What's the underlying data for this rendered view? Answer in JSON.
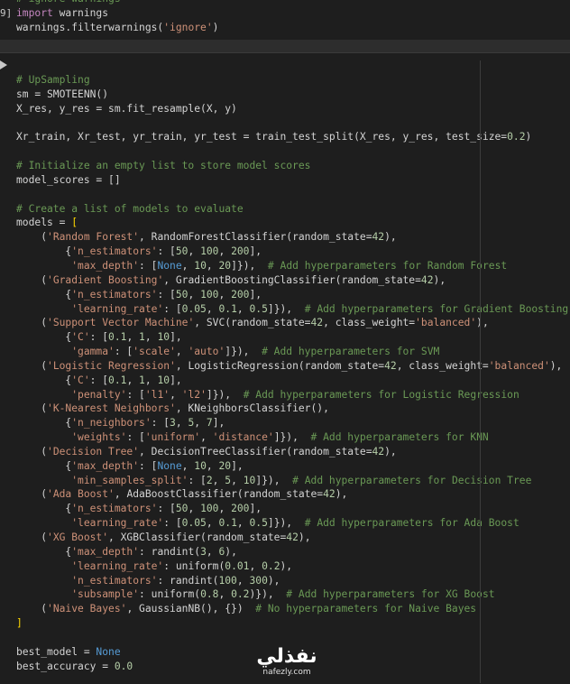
{
  "cells": [
    {
      "execution_count": "9]",
      "lines": [
        [
          {
            "t": "c",
            "s": "# ignore warnings"
          }
        ],
        [
          {
            "t": "k",
            "s": "import"
          },
          {
            "t": "p",
            "s": " warnings"
          }
        ],
        [
          {
            "t": "p",
            "s": "warnings.filterwarnings("
          },
          {
            "t": "s",
            "s": "'ignore'"
          },
          {
            "t": "p",
            "s": ")"
          }
        ]
      ]
    },
    {
      "lines": [
        [
          {
            "t": "c",
            "s": "# UpSampling"
          }
        ],
        [
          {
            "t": "p",
            "s": "sm = SMOTEENN()"
          }
        ],
        [
          {
            "t": "p",
            "s": "X_res, y_res = sm.fit_resample(X, y)"
          }
        ],
        [],
        [
          {
            "t": "p",
            "s": "Xr_train, Xr_test, yr_train, yr_test = train_test_split(X_res, y_res, test_size="
          },
          {
            "t": "n",
            "s": "0.2"
          },
          {
            "t": "p",
            "s": ")"
          }
        ],
        [],
        [
          {
            "t": "c",
            "s": "# Initialize an empty list to store model scores"
          }
        ],
        [
          {
            "t": "p",
            "s": "model_scores = []"
          }
        ],
        [],
        [
          {
            "t": "c",
            "s": "# Create a list of models to evaluate"
          }
        ],
        [
          {
            "t": "p",
            "s": "models = "
          },
          {
            "t": "b",
            "s": "["
          }
        ],
        [
          {
            "t": "p",
            "s": "    ("
          },
          {
            "t": "s",
            "s": "'Random Forest'"
          },
          {
            "t": "p",
            "s": ", RandomForestClassifier(random_state="
          },
          {
            "t": "n",
            "s": "42"
          },
          {
            "t": "p",
            "s": "),"
          }
        ],
        [
          {
            "t": "p",
            "s": "        {"
          },
          {
            "t": "s",
            "s": "'n_estimators'"
          },
          {
            "t": "p",
            "s": ": ["
          },
          {
            "t": "n",
            "s": "50"
          },
          {
            "t": "p",
            "s": ", "
          },
          {
            "t": "n",
            "s": "100"
          },
          {
            "t": "p",
            "s": ", "
          },
          {
            "t": "n",
            "s": "200"
          },
          {
            "t": "p",
            "s": "],"
          }
        ],
        [
          {
            "t": "p",
            "s": "         "
          },
          {
            "t": "s",
            "s": "'max_depth'"
          },
          {
            "t": "p",
            "s": ": ["
          },
          {
            "t": "kw",
            "s": "None"
          },
          {
            "t": "p",
            "s": ", "
          },
          {
            "t": "n",
            "s": "10"
          },
          {
            "t": "p",
            "s": ", "
          },
          {
            "t": "n",
            "s": "20"
          },
          {
            "t": "p",
            "s": "]}),  "
          },
          {
            "t": "c",
            "s": "# Add hyperparameters for Random Forest"
          }
        ],
        [
          {
            "t": "p",
            "s": "    ("
          },
          {
            "t": "s",
            "s": "'Gradient Boosting'"
          },
          {
            "t": "p",
            "s": ", GradientBoostingClassifier(random_state="
          },
          {
            "t": "n",
            "s": "42"
          },
          {
            "t": "p",
            "s": "),"
          }
        ],
        [
          {
            "t": "p",
            "s": "        {"
          },
          {
            "t": "s",
            "s": "'n_estimators'"
          },
          {
            "t": "p",
            "s": ": ["
          },
          {
            "t": "n",
            "s": "50"
          },
          {
            "t": "p",
            "s": ", "
          },
          {
            "t": "n",
            "s": "100"
          },
          {
            "t": "p",
            "s": ", "
          },
          {
            "t": "n",
            "s": "200"
          },
          {
            "t": "p",
            "s": "],"
          }
        ],
        [
          {
            "t": "p",
            "s": "         "
          },
          {
            "t": "s",
            "s": "'learning_rate'"
          },
          {
            "t": "p",
            "s": ": ["
          },
          {
            "t": "n",
            "s": "0.05"
          },
          {
            "t": "p",
            "s": ", "
          },
          {
            "t": "n",
            "s": "0.1"
          },
          {
            "t": "p",
            "s": ", "
          },
          {
            "t": "n",
            "s": "0.5"
          },
          {
            "t": "p",
            "s": "]}),  "
          },
          {
            "t": "c",
            "s": "# Add hyperparameters for Gradient Boosting"
          }
        ],
        [
          {
            "t": "p",
            "s": "    ("
          },
          {
            "t": "s",
            "s": "'Support Vector Machine'"
          },
          {
            "t": "p",
            "s": ", SVC(random_state="
          },
          {
            "t": "n",
            "s": "42"
          },
          {
            "t": "p",
            "s": ", class_weight="
          },
          {
            "t": "s",
            "s": "'balanced'"
          },
          {
            "t": "p",
            "s": "),"
          }
        ],
        [
          {
            "t": "p",
            "s": "        {"
          },
          {
            "t": "s",
            "s": "'C'"
          },
          {
            "t": "p",
            "s": ": ["
          },
          {
            "t": "n",
            "s": "0.1"
          },
          {
            "t": "p",
            "s": ", "
          },
          {
            "t": "n",
            "s": "1"
          },
          {
            "t": "p",
            "s": ", "
          },
          {
            "t": "n",
            "s": "10"
          },
          {
            "t": "p",
            "s": "],"
          }
        ],
        [
          {
            "t": "p",
            "s": "         "
          },
          {
            "t": "s",
            "s": "'gamma'"
          },
          {
            "t": "p",
            "s": ": ["
          },
          {
            "t": "s",
            "s": "'scale'"
          },
          {
            "t": "p",
            "s": ", "
          },
          {
            "t": "s",
            "s": "'auto'"
          },
          {
            "t": "p",
            "s": "]}),  "
          },
          {
            "t": "c",
            "s": "# Add hyperparameters for SVM"
          }
        ],
        [
          {
            "t": "p",
            "s": "    ("
          },
          {
            "t": "s",
            "s": "'Logistic Regression'"
          },
          {
            "t": "p",
            "s": ", LogisticRegression(random_state="
          },
          {
            "t": "n",
            "s": "42"
          },
          {
            "t": "p",
            "s": ", class_weight="
          },
          {
            "t": "s",
            "s": "'balanced'"
          },
          {
            "t": "p",
            "s": "),"
          }
        ],
        [
          {
            "t": "p",
            "s": "        {"
          },
          {
            "t": "s",
            "s": "'C'"
          },
          {
            "t": "p",
            "s": ": ["
          },
          {
            "t": "n",
            "s": "0.1"
          },
          {
            "t": "p",
            "s": ", "
          },
          {
            "t": "n",
            "s": "1"
          },
          {
            "t": "p",
            "s": ", "
          },
          {
            "t": "n",
            "s": "10"
          },
          {
            "t": "p",
            "s": "],"
          }
        ],
        [
          {
            "t": "p",
            "s": "         "
          },
          {
            "t": "s",
            "s": "'penalty'"
          },
          {
            "t": "p",
            "s": ": ["
          },
          {
            "t": "s",
            "s": "'l1'"
          },
          {
            "t": "p",
            "s": ", "
          },
          {
            "t": "s",
            "s": "'l2'"
          },
          {
            "t": "p",
            "s": "]}),  "
          },
          {
            "t": "c",
            "s": "# Add hyperparameters for Logistic Regression"
          }
        ],
        [
          {
            "t": "p",
            "s": "    ("
          },
          {
            "t": "s",
            "s": "'K-Nearest Neighbors'"
          },
          {
            "t": "p",
            "s": ", KNeighborsClassifier(),"
          }
        ],
        [
          {
            "t": "p",
            "s": "        {"
          },
          {
            "t": "s",
            "s": "'n_neighbors'"
          },
          {
            "t": "p",
            "s": ": ["
          },
          {
            "t": "n",
            "s": "3"
          },
          {
            "t": "p",
            "s": ", "
          },
          {
            "t": "n",
            "s": "5"
          },
          {
            "t": "p",
            "s": ", "
          },
          {
            "t": "n",
            "s": "7"
          },
          {
            "t": "p",
            "s": "],"
          }
        ],
        [
          {
            "t": "p",
            "s": "         "
          },
          {
            "t": "s",
            "s": "'weights'"
          },
          {
            "t": "p",
            "s": ": ["
          },
          {
            "t": "s",
            "s": "'uniform'"
          },
          {
            "t": "p",
            "s": ", "
          },
          {
            "t": "s",
            "s": "'distance'"
          },
          {
            "t": "p",
            "s": "]}),  "
          },
          {
            "t": "c",
            "s": "# Add hyperparameters for KNN"
          }
        ],
        [
          {
            "t": "p",
            "s": "    ("
          },
          {
            "t": "s",
            "s": "'Decision Tree'"
          },
          {
            "t": "p",
            "s": ", DecisionTreeClassifier(random_state="
          },
          {
            "t": "n",
            "s": "42"
          },
          {
            "t": "p",
            "s": "),"
          }
        ],
        [
          {
            "t": "p",
            "s": "        {"
          },
          {
            "t": "s",
            "s": "'max_depth'"
          },
          {
            "t": "p",
            "s": ": ["
          },
          {
            "t": "kw",
            "s": "None"
          },
          {
            "t": "p",
            "s": ", "
          },
          {
            "t": "n",
            "s": "10"
          },
          {
            "t": "p",
            "s": ", "
          },
          {
            "t": "n",
            "s": "20"
          },
          {
            "t": "p",
            "s": "],"
          }
        ],
        [
          {
            "t": "p",
            "s": "         "
          },
          {
            "t": "s",
            "s": "'min_samples_split'"
          },
          {
            "t": "p",
            "s": ": ["
          },
          {
            "t": "n",
            "s": "2"
          },
          {
            "t": "p",
            "s": ", "
          },
          {
            "t": "n",
            "s": "5"
          },
          {
            "t": "p",
            "s": ", "
          },
          {
            "t": "n",
            "s": "10"
          },
          {
            "t": "p",
            "s": "]}),  "
          },
          {
            "t": "c",
            "s": "# Add hyperparameters for Decision Tree"
          }
        ],
        [
          {
            "t": "p",
            "s": "    ("
          },
          {
            "t": "s",
            "s": "'Ada Boost'"
          },
          {
            "t": "p",
            "s": ", AdaBoostClassifier(random_state="
          },
          {
            "t": "n",
            "s": "42"
          },
          {
            "t": "p",
            "s": "),"
          }
        ],
        [
          {
            "t": "p",
            "s": "        {"
          },
          {
            "t": "s",
            "s": "'n_estimators'"
          },
          {
            "t": "p",
            "s": ": ["
          },
          {
            "t": "n",
            "s": "50"
          },
          {
            "t": "p",
            "s": ", "
          },
          {
            "t": "n",
            "s": "100"
          },
          {
            "t": "p",
            "s": ", "
          },
          {
            "t": "n",
            "s": "200"
          },
          {
            "t": "p",
            "s": "],"
          }
        ],
        [
          {
            "t": "p",
            "s": "         "
          },
          {
            "t": "s",
            "s": "'learning_rate'"
          },
          {
            "t": "p",
            "s": ": ["
          },
          {
            "t": "n",
            "s": "0.05"
          },
          {
            "t": "p",
            "s": ", "
          },
          {
            "t": "n",
            "s": "0.1"
          },
          {
            "t": "p",
            "s": ", "
          },
          {
            "t": "n",
            "s": "0.5"
          },
          {
            "t": "p",
            "s": "]}),  "
          },
          {
            "t": "c",
            "s": "# Add hyperparameters for Ada Boost"
          }
        ],
        [
          {
            "t": "p",
            "s": "    ("
          },
          {
            "t": "s",
            "s": "'XG Boost'"
          },
          {
            "t": "p",
            "s": ", XGBClassifier(random_state="
          },
          {
            "t": "n",
            "s": "42"
          },
          {
            "t": "p",
            "s": "),"
          }
        ],
        [
          {
            "t": "p",
            "s": "        {"
          },
          {
            "t": "s",
            "s": "'max_depth'"
          },
          {
            "t": "p",
            "s": ": randint("
          },
          {
            "t": "n",
            "s": "3"
          },
          {
            "t": "p",
            "s": ", "
          },
          {
            "t": "n",
            "s": "6"
          },
          {
            "t": "p",
            "s": "),"
          }
        ],
        [
          {
            "t": "p",
            "s": "         "
          },
          {
            "t": "s",
            "s": "'learning_rate'"
          },
          {
            "t": "p",
            "s": ": uniform("
          },
          {
            "t": "n",
            "s": "0.01"
          },
          {
            "t": "p",
            "s": ", "
          },
          {
            "t": "n",
            "s": "0.2"
          },
          {
            "t": "p",
            "s": "),"
          }
        ],
        [
          {
            "t": "p",
            "s": "         "
          },
          {
            "t": "s",
            "s": "'n_estimators'"
          },
          {
            "t": "p",
            "s": ": randint("
          },
          {
            "t": "n",
            "s": "100"
          },
          {
            "t": "p",
            "s": ", "
          },
          {
            "t": "n",
            "s": "300"
          },
          {
            "t": "p",
            "s": "),"
          }
        ],
        [
          {
            "t": "p",
            "s": "         "
          },
          {
            "t": "s",
            "s": "'subsample'"
          },
          {
            "t": "p",
            "s": ": uniform("
          },
          {
            "t": "n",
            "s": "0.8"
          },
          {
            "t": "p",
            "s": ", "
          },
          {
            "t": "n",
            "s": "0.2"
          },
          {
            "t": "p",
            "s": ")}),  "
          },
          {
            "t": "c",
            "s": "# Add hyperparameters for XG Boost"
          }
        ],
        [
          {
            "t": "p",
            "s": "    ("
          },
          {
            "t": "s",
            "s": "'Naive Bayes'"
          },
          {
            "t": "p",
            "s": ", GaussianNB(), {})  "
          },
          {
            "t": "c",
            "s": "# No hyperparameters for Naive Bayes"
          }
        ],
        [
          {
            "t": "b",
            "s": "]"
          }
        ],
        [],
        [
          {
            "t": "p",
            "s": "best_model = "
          },
          {
            "t": "kw",
            "s": "None"
          }
        ],
        [
          {
            "t": "p",
            "s": "best_accuracy = "
          },
          {
            "t": "n",
            "s": "0.0"
          }
        ]
      ]
    }
  ],
  "watermark": {
    "arabic": "نفذلي",
    "latin": "nafezly.com"
  },
  "colors": {
    "background": "#1e1e1e",
    "comment": "#6a9955",
    "keyword_import": "#c586c0",
    "keyword_constant": "#569cd6",
    "string": "#ce9178",
    "number": "#b5cea8",
    "bracket": "#ffd700",
    "text": "#d4d4d4"
  }
}
